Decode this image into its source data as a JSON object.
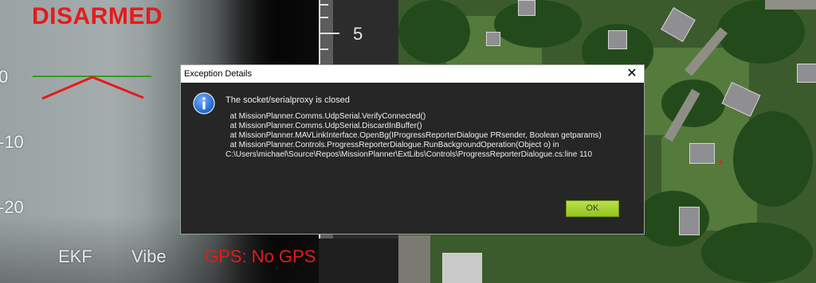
{
  "hud": {
    "arm_status": "DISARMED",
    "pitch_labels": {
      "p0": "0",
      "n10": "-10",
      "n20": "-20"
    },
    "ekf_label": "EKF",
    "vibe_label": "Vibe",
    "gps_status": "GPS: No GPS",
    "speed_tape_value": "5",
    "colors": {
      "arm_status": "#e61a1a",
      "horizon": "#2f9e1f",
      "attitude": "#e61a1a"
    }
  },
  "dialog": {
    "title": "Exception Details",
    "close_label": "✕",
    "icon": "info-icon",
    "message": "The socket/serialproxy is closed",
    "stack_trace": "  at MissionPlanner.Comms.UdpSerial.VerifyConnected()\n  at MissionPlanner.Comms.UdpSerial.DiscardInBuffer()\n  at MissionPlanner.MAVLinkInterface.OpenBg(IProgressReporterDialogue PRsender, Boolean getparams)\n  at MissionPlanner.Controls.ProgressReporterDialogue.RunBackgroundOperation(Object o) in C:\\Users\\michael\\Source\\Repos\\MissionPlanner\\ExtLibs\\Controls\\ProgressReporterDialogue.cs:line 110",
    "ok_label": "OK"
  }
}
